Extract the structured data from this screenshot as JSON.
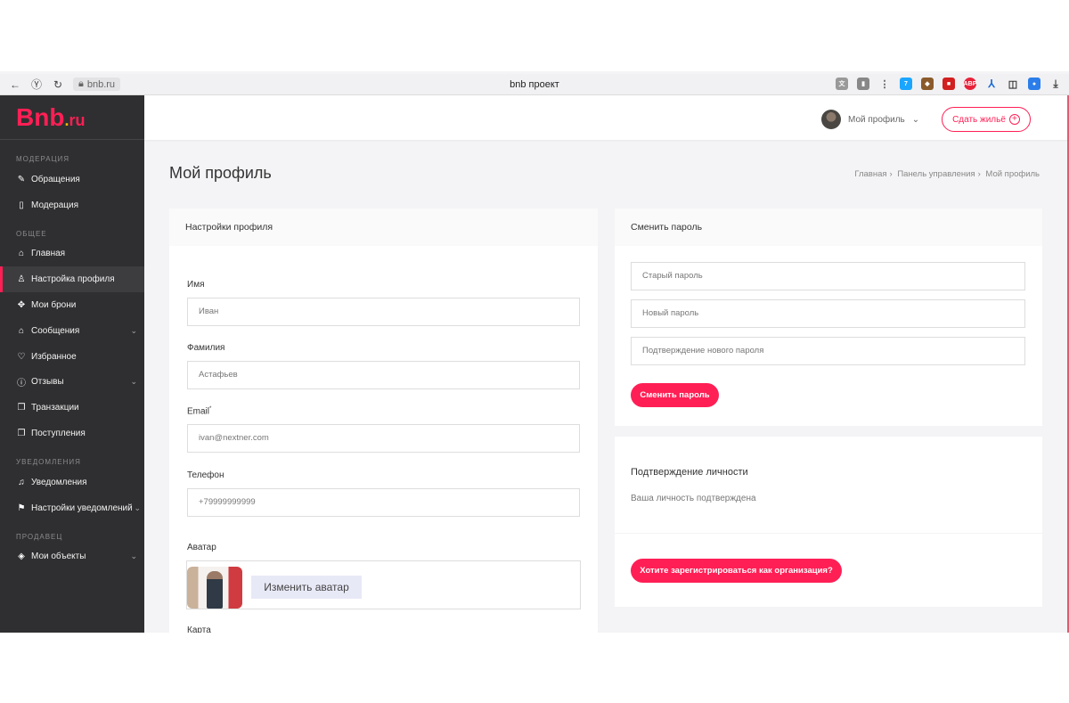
{
  "browser": {
    "url": "bnb.ru",
    "title": "bnb проект"
  },
  "logo": {
    "b": "B",
    "nb": "nb",
    "dot": ".",
    "ru": "ru"
  },
  "sidebar": {
    "sections": [
      {
        "title": "МОДЕРАЦИЯ"
      },
      {
        "title": "ОБЩЕЕ"
      },
      {
        "title": "УВЕДОМЛЕНИЯ"
      },
      {
        "title": "ПРОДАВЕЦ"
      }
    ],
    "items": [
      {
        "label": "Обращения",
        "icon": "edit-icon"
      },
      {
        "label": "Модерация",
        "icon": "book-icon"
      },
      {
        "label": "Главная",
        "icon": "home-icon"
      },
      {
        "label": "Настройка профиля",
        "icon": "user-icon"
      },
      {
        "label": "Мои брони",
        "icon": "target-icon"
      },
      {
        "label": "Сообщения",
        "icon": "home-icon"
      },
      {
        "label": "Избранное",
        "icon": "heart-icon"
      },
      {
        "label": "Отзывы",
        "icon": "info-icon"
      },
      {
        "label": "Транзакции",
        "icon": "copy-icon"
      },
      {
        "label": "Поступления",
        "icon": "copy-icon"
      },
      {
        "label": "Уведомления",
        "icon": "bell-icon"
      },
      {
        "label": "Настройки уведомлений",
        "icon": "signpost-icon"
      },
      {
        "label": "Мои объекты",
        "icon": "layers-icon"
      }
    ]
  },
  "header": {
    "profile_label": "Мой профиль",
    "add_button": "Сдать жильё"
  },
  "page": {
    "title": "Мой профиль",
    "breadcrumbs": [
      "Главная",
      "Панель управления",
      "Мой профиль"
    ]
  },
  "profile_card": {
    "title": "Настройки профиля",
    "fields": [
      {
        "label": "Имя",
        "value": "Иван"
      },
      {
        "label": "Фамилия",
        "value": "Астафьев"
      },
      {
        "label": "Email",
        "value": "ivan@nextner.com"
      },
      {
        "label": "Телефон",
        "value": "+79999999999"
      }
    ],
    "required_mark": "*",
    "avatar_label": "Аватар",
    "avatar_button": "Изменить аватар",
    "map_label": "Карта"
  },
  "password_card": {
    "title": "Сменить пароль",
    "old_placeholder": "Старый пароль",
    "new_placeholder": "Новый пароль",
    "confirm_placeholder": "Подтверждение нового пароля",
    "button": "Сменить пароль"
  },
  "identity_card": {
    "title": "Подтверждение личности",
    "status": "Ваша личность подтверждена"
  },
  "org_card": {
    "button": "Хотите зарегистрироваться как организация?"
  },
  "colors": {
    "accent": "#ff1f55",
    "sidebar_bg": "#2f2f31",
    "page_bg": "#f4f4f6"
  }
}
